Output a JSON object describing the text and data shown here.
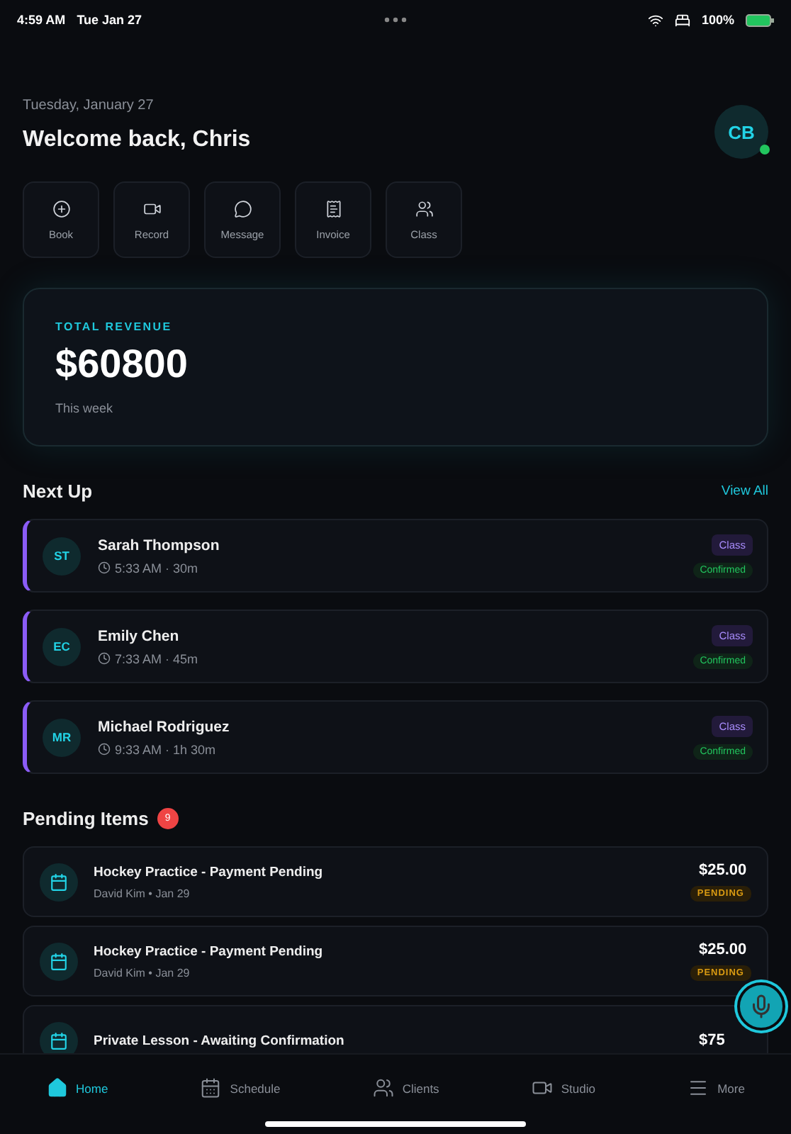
{
  "status_bar": {
    "time": "4:59 AM",
    "date": "Tue Jan 27",
    "battery": "100%"
  },
  "header": {
    "date": "Tuesday, January 27",
    "greeting": "Welcome back, Chris",
    "avatar": "CB",
    "online": true
  },
  "quick_actions": [
    {
      "kind": "book",
      "label": "Book"
    },
    {
      "kind": "record",
      "label": "Record"
    },
    {
      "kind": "message",
      "label": "Message"
    },
    {
      "kind": "invoice",
      "label": "Invoice"
    },
    {
      "kind": "class",
      "label": "Class"
    }
  ],
  "revenue": {
    "label": "TOTAL REVENUE",
    "amount": "$60800",
    "period": "This week"
  },
  "next_up": {
    "title": "Next Up",
    "link": "View All",
    "items": [
      {
        "initials": "ST",
        "name": "Sarah Thompson",
        "time": "5:33 AM · 30m",
        "type": "Class",
        "status": "Confirmed"
      },
      {
        "initials": "EC",
        "name": "Emily Chen",
        "time": "7:33 AM · 45m",
        "type": "Class",
        "status": "Confirmed"
      },
      {
        "initials": "MR",
        "name": "Michael Rodriguez",
        "time": "9:33 AM · 1h 30m",
        "type": "Class",
        "status": "Confirmed"
      }
    ]
  },
  "pending": {
    "title": "Pending Items",
    "count": "9",
    "items": [
      {
        "title": "Hockey Practice - Payment Pending",
        "subtitle": "David Kim • Jan 29",
        "amount": "$25.00",
        "status": "PENDING"
      },
      {
        "title": "Hockey Practice - Payment Pending",
        "subtitle": "David Kim • Jan 29",
        "amount": "$25.00",
        "status": "PENDING"
      },
      {
        "title": "Private Lesson - Awaiting Confirmation",
        "amount": "$75"
      }
    ]
  },
  "tab_bar": [
    {
      "kind": "home",
      "label": "Home",
      "selected": true
    },
    {
      "kind": "schedule",
      "label": "Schedule",
      "selected": false
    },
    {
      "kind": "clients",
      "label": "Clients",
      "selected": false
    },
    {
      "kind": "studio",
      "label": "Studio",
      "selected": false
    },
    {
      "kind": "more",
      "label": "More",
      "selected": false
    }
  ]
}
